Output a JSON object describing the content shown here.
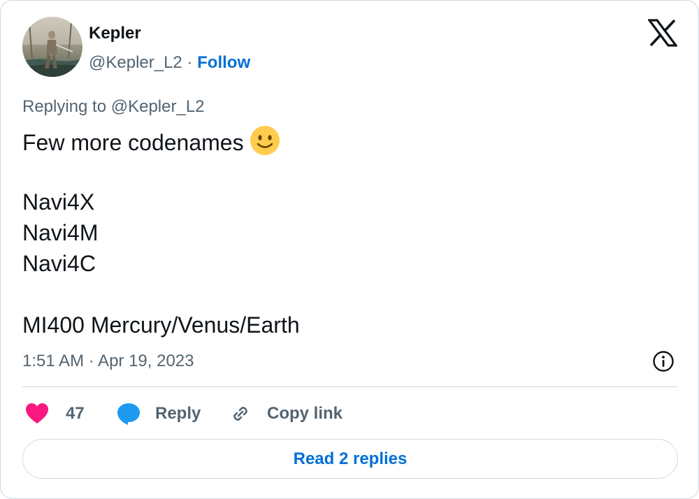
{
  "author": {
    "display_name": "Kepler",
    "handle": "@Kepler_L2",
    "separator": "·",
    "follow_label": "Follow",
    "avatar_icon": "profile-avatar-image"
  },
  "brand": {
    "logo_icon": "x-logo-icon"
  },
  "tweet": {
    "replying_to": "Replying to @Kepler_L2",
    "lines": [
      "Few more codenames",
      "",
      "Navi4X",
      "Navi4M",
      "Navi4C",
      "",
      "MI400 Mercury/Venus/Earth"
    ],
    "emoji": "slightly-smiling-face-emoji",
    "timestamp": "1:51 AM · Apr 19, 2023"
  },
  "actions": {
    "like_count": "47",
    "reply_label": "Reply",
    "copy_link_label": "Copy link"
  },
  "footer": {
    "read_replies_label": "Read 2 replies"
  },
  "colors": {
    "text_primary": "#0f1419",
    "text_secondary": "#536471",
    "link_blue": "#006fd6",
    "like_pink": "#f91880",
    "reply_blue": "#1d9bf0",
    "border": "#cfd9de",
    "emoji_yellow": "#ffcc4d"
  }
}
